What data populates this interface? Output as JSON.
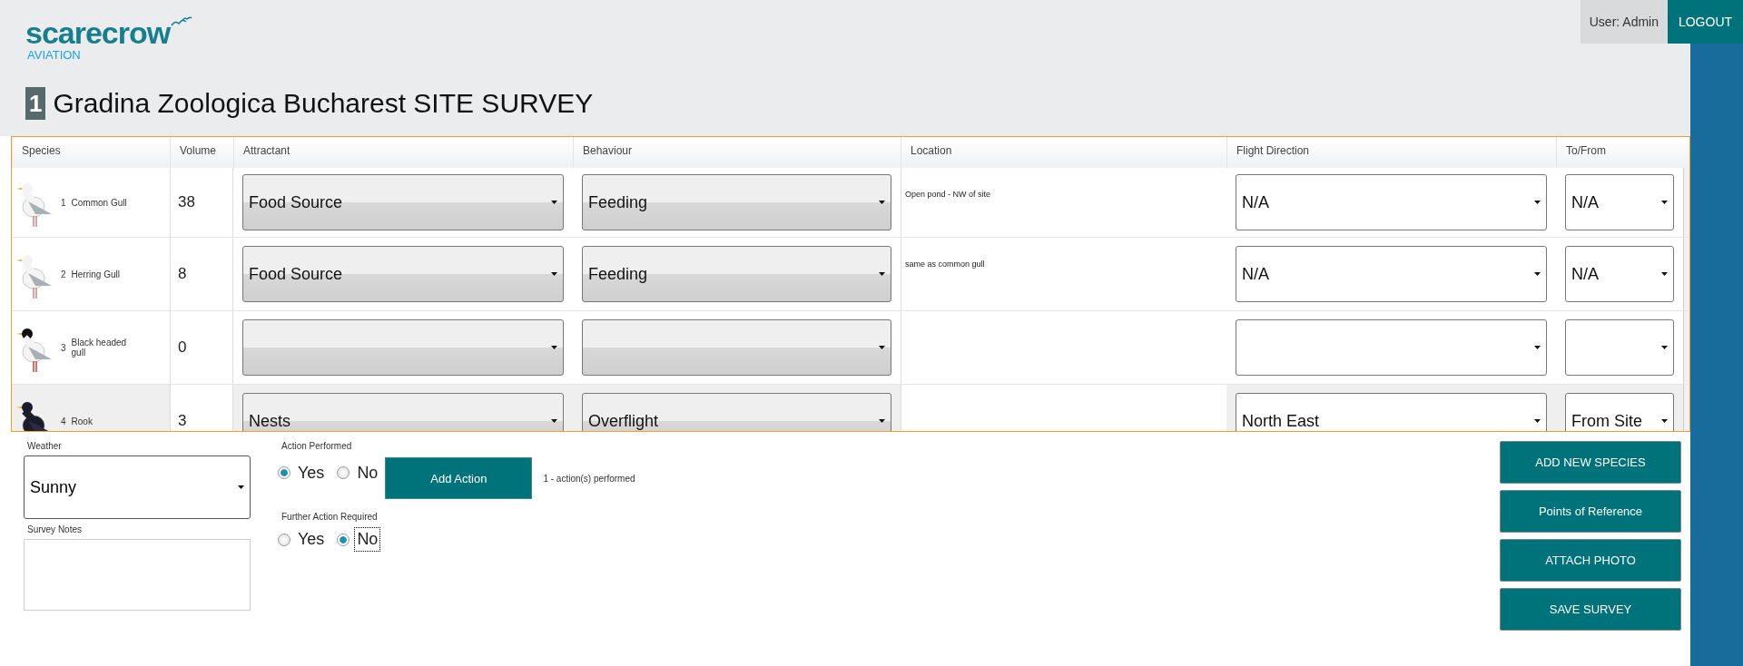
{
  "header": {
    "logo": {
      "name": "scarecrow",
      "subtitle": "AVIATION"
    },
    "user": "User: Admin",
    "logout": "LOGOUT",
    "survey_number": "1",
    "title": "Gradina Zoologica Bucharest SITE SURVEY"
  },
  "table": {
    "columns": [
      "Species",
      "Volume",
      "Attractant",
      "Behaviour",
      "Location",
      "Flight Direction",
      "To/From"
    ],
    "rows": [
      {
        "number": "1",
        "species": "Common Gull",
        "kind": "gull",
        "volume": "38",
        "attractant": "Food Source",
        "behaviour": "Feeding",
        "location": "Open pond - NW of site",
        "flight_direction": "N/A",
        "to_from": "N/A",
        "selected": false
      },
      {
        "number": "2",
        "species": "Herring Gull",
        "kind": "gull",
        "volume": "8",
        "attractant": "Food Source",
        "behaviour": "Feeding",
        "location": "same as common gull",
        "flight_direction": "N/A",
        "to_from": "N/A",
        "selected": false
      },
      {
        "number": "3",
        "species": "Black headed gull",
        "kind": "blackhead",
        "volume": "0",
        "attractant": "",
        "behaviour": "",
        "location": "",
        "flight_direction": "",
        "to_from": "",
        "selected": false
      },
      {
        "number": "4",
        "species": "Rook",
        "kind": "rook",
        "volume": "3",
        "attractant": "Nests",
        "behaviour": "Overflight",
        "location": "",
        "flight_direction": "North East",
        "to_from": "From Site",
        "selected": true
      }
    ]
  },
  "weather": {
    "label": "Weather",
    "value": "Sunny"
  },
  "survey_notes": {
    "label": "Survey Notes"
  },
  "action_performed": {
    "label": "Action Performed",
    "options": [
      {
        "label": "Yes",
        "selected": true,
        "focused": false
      },
      {
        "label": "No",
        "selected": false,
        "focused": false
      }
    ],
    "button": "Add Action",
    "count": "1 - action(s) performed"
  },
  "further_action": {
    "label": "Further Action Required",
    "options": [
      {
        "label": "Yes",
        "selected": false,
        "focused": false
      },
      {
        "label": "No",
        "selected": true,
        "focused": true
      }
    ]
  },
  "buttons": [
    "ADD NEW SPECIES",
    "Points of Reference",
    "ATTACH PHOTO",
    "SAVE SURVEY"
  ]
}
